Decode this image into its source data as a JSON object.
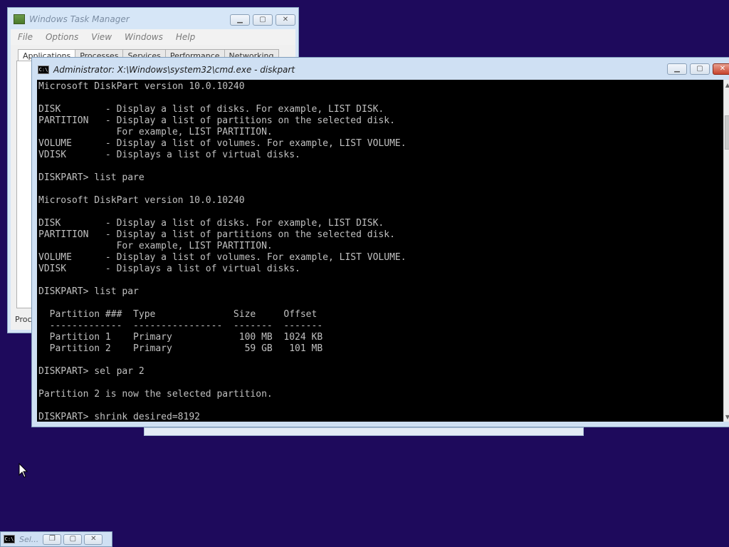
{
  "task_manager": {
    "title": "Windows Task Manager",
    "menu": [
      "File",
      "Options",
      "View",
      "Windows",
      "Help"
    ],
    "tabs": [
      "Applications",
      "Processes",
      "Services",
      "Performance",
      "Networking"
    ],
    "status": "Proce"
  },
  "cmd": {
    "title": "Administrator: X:\\Windows\\system32\\cmd.exe - diskpart",
    "icon_label": "C:\\",
    "lines": [
      "Microsoft DiskPart version 10.0.10240",
      "",
      "DISK        - Display a list of disks. For example, LIST DISK.",
      "PARTITION   - Display a list of partitions on the selected disk.",
      "              For example, LIST PARTITION.",
      "VOLUME      - Display a list of volumes. For example, LIST VOLUME.",
      "VDISK       - Displays a list of virtual disks.",
      "",
      "DISKPART> list pare",
      "",
      "Microsoft DiskPart version 10.0.10240",
      "",
      "DISK        - Display a list of disks. For example, LIST DISK.",
      "PARTITION   - Display a list of partitions on the selected disk.",
      "              For example, LIST PARTITION.",
      "VOLUME      - Display a list of volumes. For example, LIST VOLUME.",
      "VDISK       - Displays a list of virtual disks.",
      "",
      "DISKPART> list par",
      "",
      "  Partition ###  Type              Size     Offset",
      "  -------------  ----------------  -------  -------",
      "  Partition 1    Primary            100 MB  1024 KB",
      "  Partition 2    Primary             59 GB   101 MB",
      "",
      "DISKPART> sel par 2",
      "",
      "Partition 2 is now the selected partition.",
      "",
      "DISKPART> shrink desired=8192"
    ]
  },
  "minimized": {
    "title": "Sel..."
  },
  "colors": {
    "desktop": "#1e0a5c",
    "console_bg": "#000000",
    "console_fg": "#c0c0c0"
  }
}
